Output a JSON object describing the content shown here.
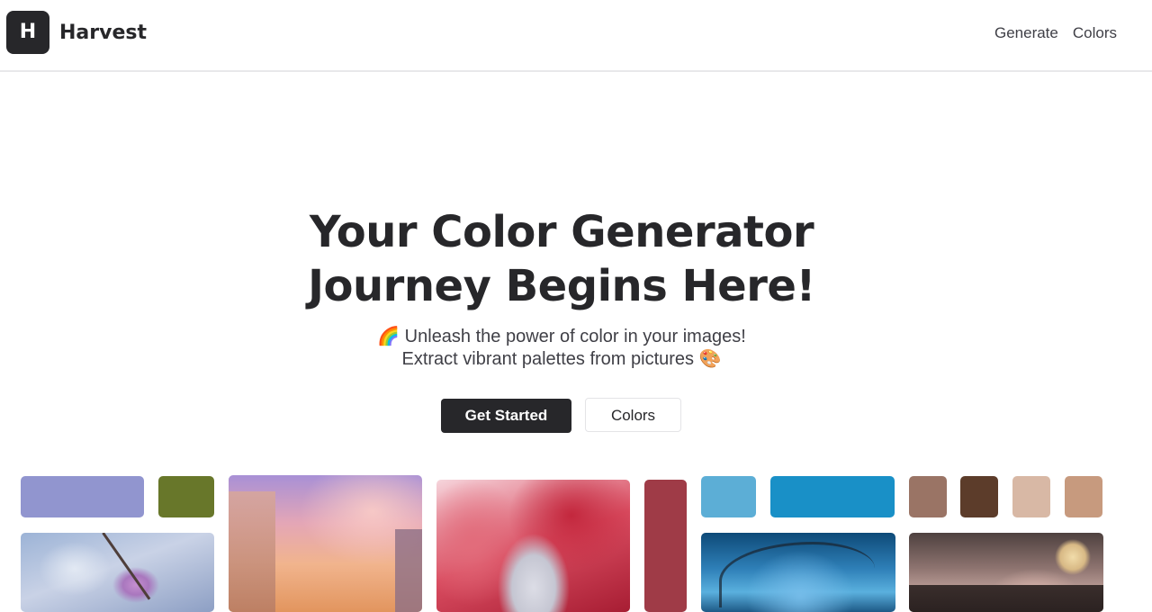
{
  "nav": {
    "logo_letter": "H",
    "brand": "Harvest",
    "links": [
      "Generate",
      "Colors"
    ]
  },
  "hero": {
    "title_line1": "Your Color Generator",
    "title_line2": "Journey Begins Here!",
    "subtitle_line1": "🌈 Unleash the power of color in your images!",
    "subtitle_line2": "Extract vibrant palettes from pictures 🎨",
    "primary_button": "Get Started",
    "secondary_button": "Colors"
  },
  "gallery": {
    "swatches": [
      {
        "name": "swatch-lavender",
        "color": "#9195cf"
      },
      {
        "name": "swatch-olive",
        "color": "#68772a"
      },
      {
        "name": "swatch-crimson",
        "color": "#9f3b47"
      },
      {
        "name": "swatch-sky-blue",
        "color": "#5caed6"
      },
      {
        "name": "swatch-ocean-blue",
        "color": "#1990c7"
      },
      {
        "name": "swatch-mocha",
        "color": "#9a7465"
      },
      {
        "name": "swatch-dark-brown",
        "color": "#5c3c2a"
      },
      {
        "name": "swatch-beige",
        "color": "#d8b8a5"
      },
      {
        "name": "swatch-tan",
        "color": "#c79a7e"
      }
    ],
    "photos": [
      "sakura-photo",
      "city-sunset-photo",
      "anime-illustration-photo",
      "night-tree-photo",
      "full-moon-photo"
    ]
  }
}
